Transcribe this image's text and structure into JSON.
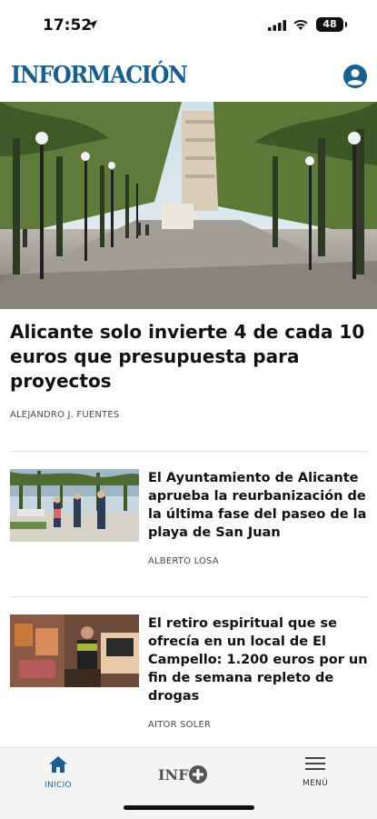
{
  "status": {
    "time": "17:52",
    "battery": "48"
  },
  "header": {
    "logo": "INFORMACIÓN"
  },
  "lead": {
    "title": "Alicante solo invierte 4 de cada 10 euros que presupuesta para proyectos",
    "author": "ALEJANDRO J. FUENTES"
  },
  "articles": [
    {
      "title": "El Ayuntamiento de Alicante aprueba la reurbanización de la última fase del paseo de la playa de San Juan",
      "author": "ALBERTO LOSA"
    },
    {
      "title": "El retiro espiritual que se ofrecía en un local de El Campello: 1.200 euros por un fin de semana repleto de drogas",
      "author": "AITOR SOLER"
    }
  ],
  "tabbar": {
    "home_label": "INICIO",
    "menu_label": "MENÚ",
    "center_label": "INF+"
  },
  "colors": {
    "brand": "#1b5f8f",
    "tabbar_bg": "#f4f4f4"
  }
}
